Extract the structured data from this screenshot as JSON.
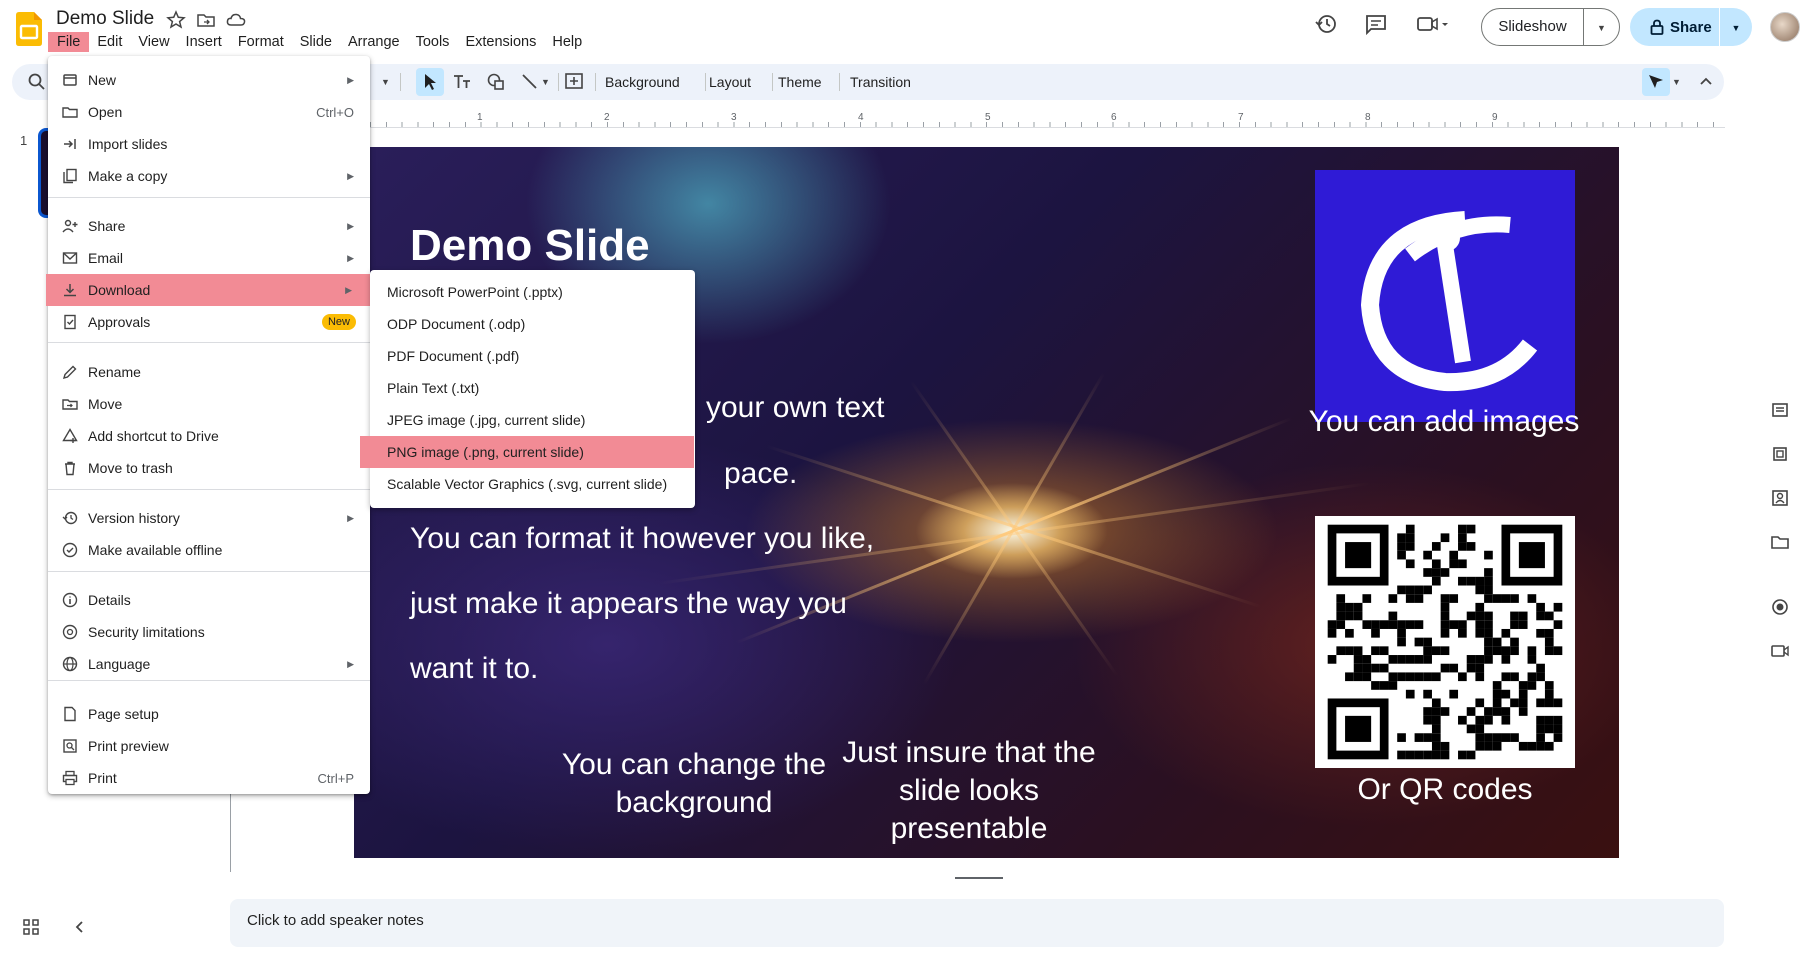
{
  "app": {
    "title": "Demo Slide"
  },
  "menubar": [
    "File",
    "Edit",
    "View",
    "Insert",
    "Format",
    "Slide",
    "Arrange",
    "Tools",
    "Extensions",
    "Help"
  ],
  "header": {
    "slideshow_label": "Slideshow",
    "share_label": "Share"
  },
  "toolbar": {
    "background": "Background",
    "layout": "Layout",
    "theme": "Theme",
    "transition": "Transition"
  },
  "ruler_numbers": [
    "1",
    "2",
    "3",
    "4",
    "5",
    "6",
    "7",
    "8",
    "9"
  ],
  "filmstrip": {
    "slide_number": "1"
  },
  "file_menu": {
    "items": [
      {
        "label": "New",
        "shortcut": "",
        "submenu": true
      },
      {
        "label": "Open",
        "shortcut": "Ctrl+O",
        "submenu": false
      },
      {
        "label": "Import slides",
        "shortcut": "",
        "submenu": false
      },
      {
        "label": "Make a copy",
        "shortcut": "",
        "submenu": true
      },
      {
        "label": "Share",
        "shortcut": "",
        "submenu": true
      },
      {
        "label": "Email",
        "shortcut": "",
        "submenu": true
      },
      {
        "label": "Download",
        "shortcut": "",
        "submenu": true
      },
      {
        "label": "Approvals",
        "shortcut": "",
        "submenu": false,
        "badge": "New"
      },
      {
        "label": "Rename",
        "shortcut": "",
        "submenu": false
      },
      {
        "label": "Move",
        "shortcut": "",
        "submenu": false
      },
      {
        "label": "Add shortcut to Drive",
        "shortcut": "",
        "submenu": false
      },
      {
        "label": "Move to trash",
        "shortcut": "",
        "submenu": false
      },
      {
        "label": "Version history",
        "shortcut": "",
        "submenu": true
      },
      {
        "label": "Make available offline",
        "shortcut": "",
        "submenu": false
      },
      {
        "label": "Details",
        "shortcut": "",
        "submenu": false
      },
      {
        "label": "Security limitations",
        "shortcut": "",
        "submenu": false
      },
      {
        "label": "Language",
        "shortcut": "",
        "submenu": true
      },
      {
        "label": "Page setup",
        "shortcut": "",
        "submenu": false
      },
      {
        "label": "Print preview",
        "shortcut": "",
        "submenu": false
      },
      {
        "label": "Print",
        "shortcut": "Ctrl+P",
        "submenu": false
      }
    ]
  },
  "download_submenu": [
    "Microsoft PowerPoint (.pptx)",
    "ODP Document (.odp)",
    "PDF Document (.pdf)",
    "Plain Text (.txt)",
    "JPEG image (.jpg, current slide)",
    "PNG image (.png, current slide)",
    "Scalable Vector Graphics (.svg, current slide)"
  ],
  "slide": {
    "title": "Demo Slide",
    "body_fragment_1": "your own text",
    "body_fragment_2": "pace.",
    "body_line_3": "You can format it however you like,",
    "body_line_4": "just make it appears the way you",
    "body_line_5": "want it to.",
    "caption_background": "You can change the background",
    "caption_presentable": "Just insure that the slide looks presentable",
    "caption_images": "You can add images",
    "caption_qr": "Or QR codes"
  },
  "notes": {
    "placeholder": "Click to add speaker notes"
  },
  "colors": {
    "highlight": "#f28b95",
    "share_bg": "#c2e7ff",
    "toolbar_bg": "#edf2fa",
    "badge": "#fbbc04",
    "logo_bg": "#2f1bd6"
  }
}
